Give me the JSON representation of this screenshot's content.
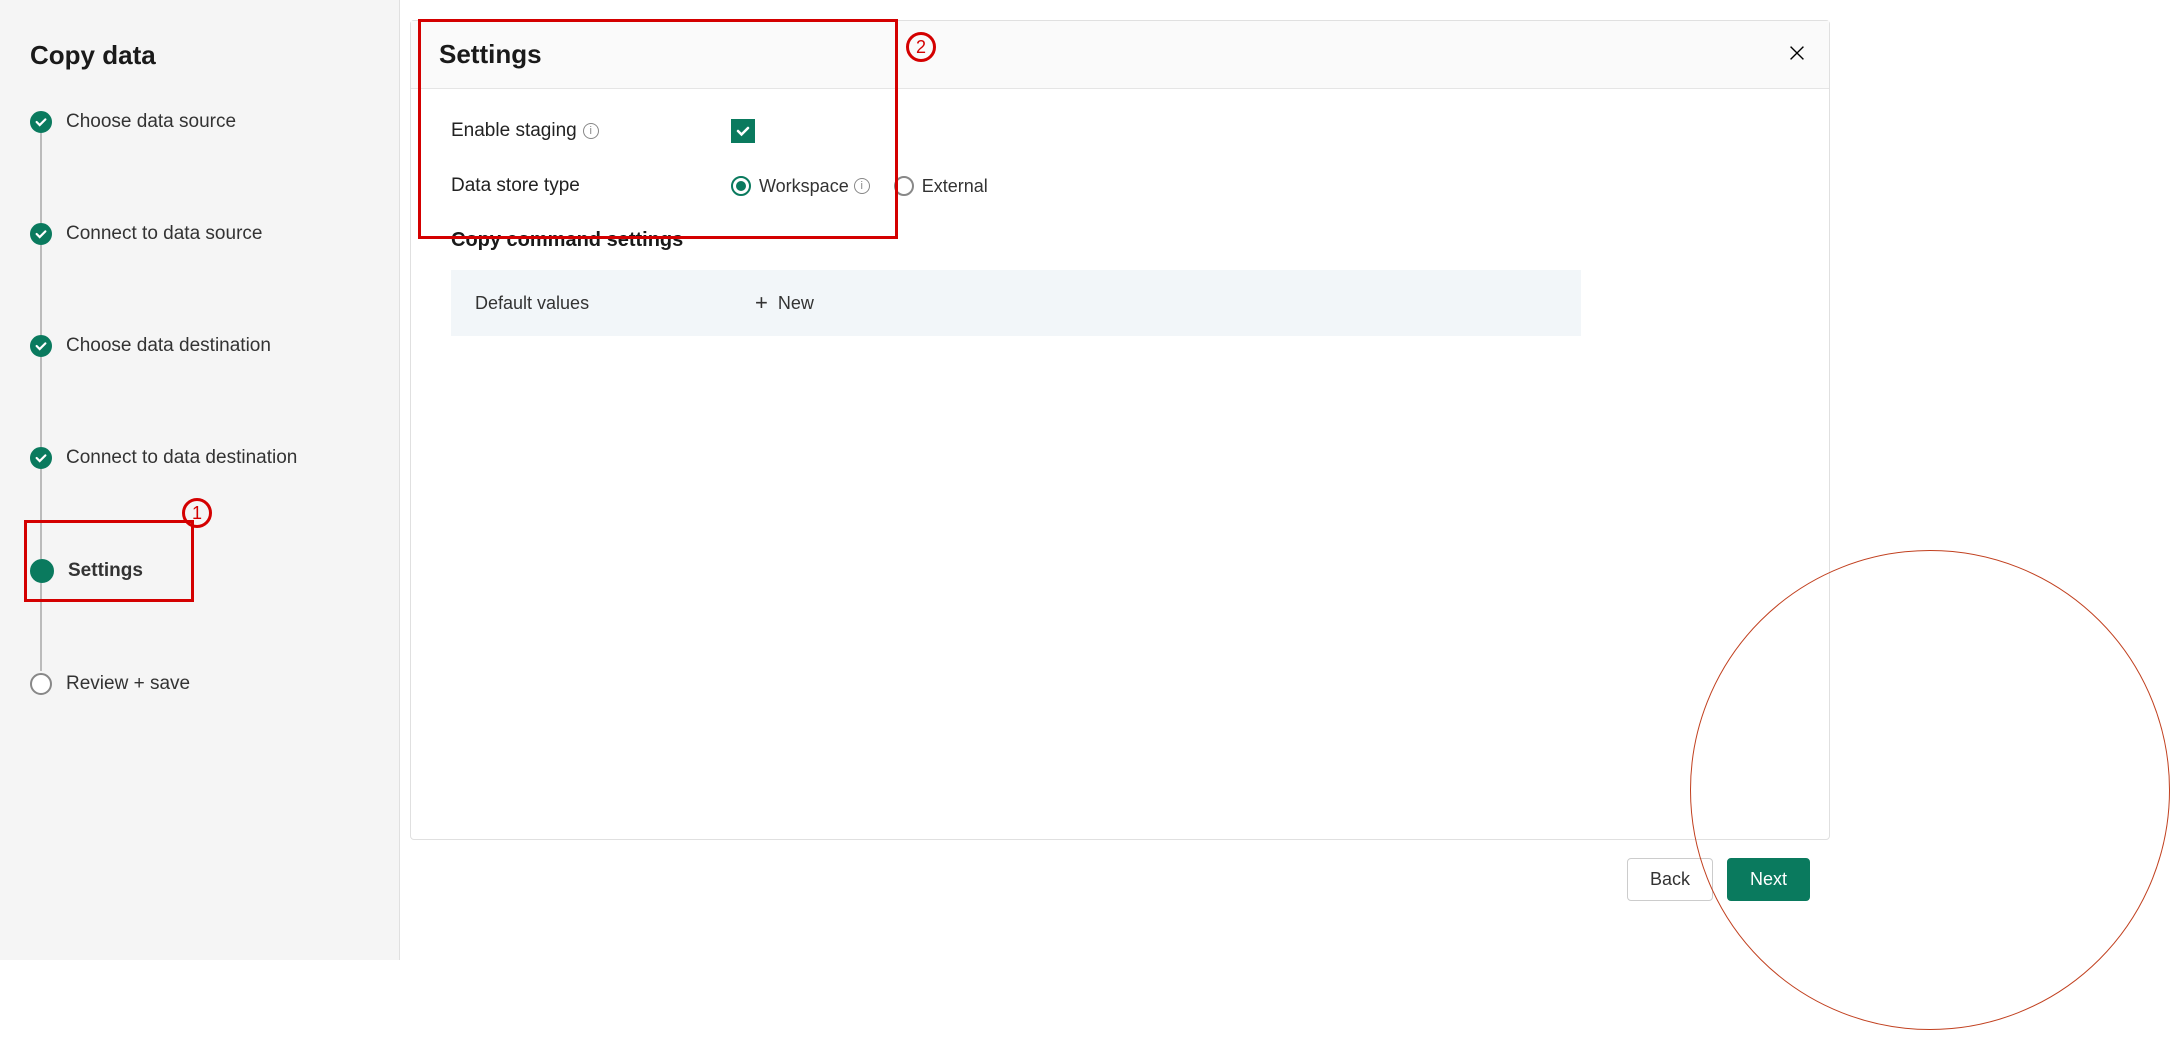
{
  "sidebar": {
    "title": "Copy data",
    "steps": [
      {
        "label": "Choose data source",
        "state": "done"
      },
      {
        "label": "Connect to data source",
        "state": "done"
      },
      {
        "label": "Choose data destination",
        "state": "done"
      },
      {
        "label": "Connect to data destination",
        "state": "done"
      },
      {
        "label": "Settings",
        "state": "current"
      },
      {
        "label": "Review + save",
        "state": "pending"
      }
    ]
  },
  "panel": {
    "title": "Settings",
    "enable_staging_label": "Enable staging",
    "enable_staging_checked": true,
    "data_store_type_label": "Data store type",
    "data_store_options": [
      {
        "label": "Workspace",
        "selected": true,
        "info": true
      },
      {
        "label": "External",
        "selected": false,
        "info": false
      }
    ],
    "copy_command_title": "Copy command settings",
    "default_values_label": "Default values",
    "new_label": "New"
  },
  "footer": {
    "back": "Back",
    "next": "Next"
  },
  "annotations": {
    "one": "1",
    "two": "2"
  }
}
